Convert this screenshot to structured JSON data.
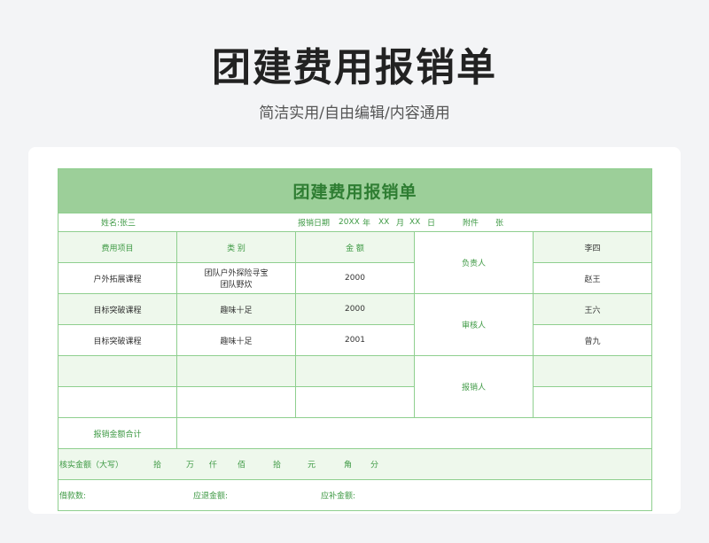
{
  "heading": "团建费用报销单",
  "subtitle": "简洁实用/自由编辑/内容通用",
  "form": {
    "title": "团建费用报销单",
    "name_label": "姓名:张三",
    "date_label": "报销日期",
    "date_year": "20XX",
    "year_unit": "年",
    "date_month": "XX",
    "month_unit": "月",
    "date_day": "XX",
    "day_unit": "日",
    "attach_label": "附件",
    "attach_unit": "张",
    "headers": {
      "item": "费用项目",
      "category": "类 别",
      "amount": "金 额"
    },
    "rows": [
      {
        "item": "户外拓展课程",
        "category_line1": "团队户外探险寻宝",
        "category_line2": "团队野炊",
        "amount": "2000"
      },
      {
        "item": "目标突破课程",
        "category_line1": "趣味十足",
        "category_line2": "",
        "amount": "2000"
      },
      {
        "item": "目标突破课程",
        "category_line1": "趣味十足",
        "category_line2": "",
        "amount": "2001"
      }
    ],
    "roles": [
      {
        "label": "负责人",
        "person1": "李四",
        "person2": "赵王"
      },
      {
        "label": "审核人",
        "person1": "王六",
        "person2": "曾九"
      },
      {
        "label": "报销人",
        "person1": "",
        "person2": ""
      }
    ],
    "total_label": "报销金额合计",
    "verified": {
      "label": "核实金额（大写）",
      "units": [
        "拾",
        "万",
        "仟",
        "佰",
        "拾",
        "元",
        "角",
        "分"
      ]
    },
    "loan_label": "借款数:",
    "refund_label": "应退金额:",
    "supplement_label": "应补金额:"
  }
}
